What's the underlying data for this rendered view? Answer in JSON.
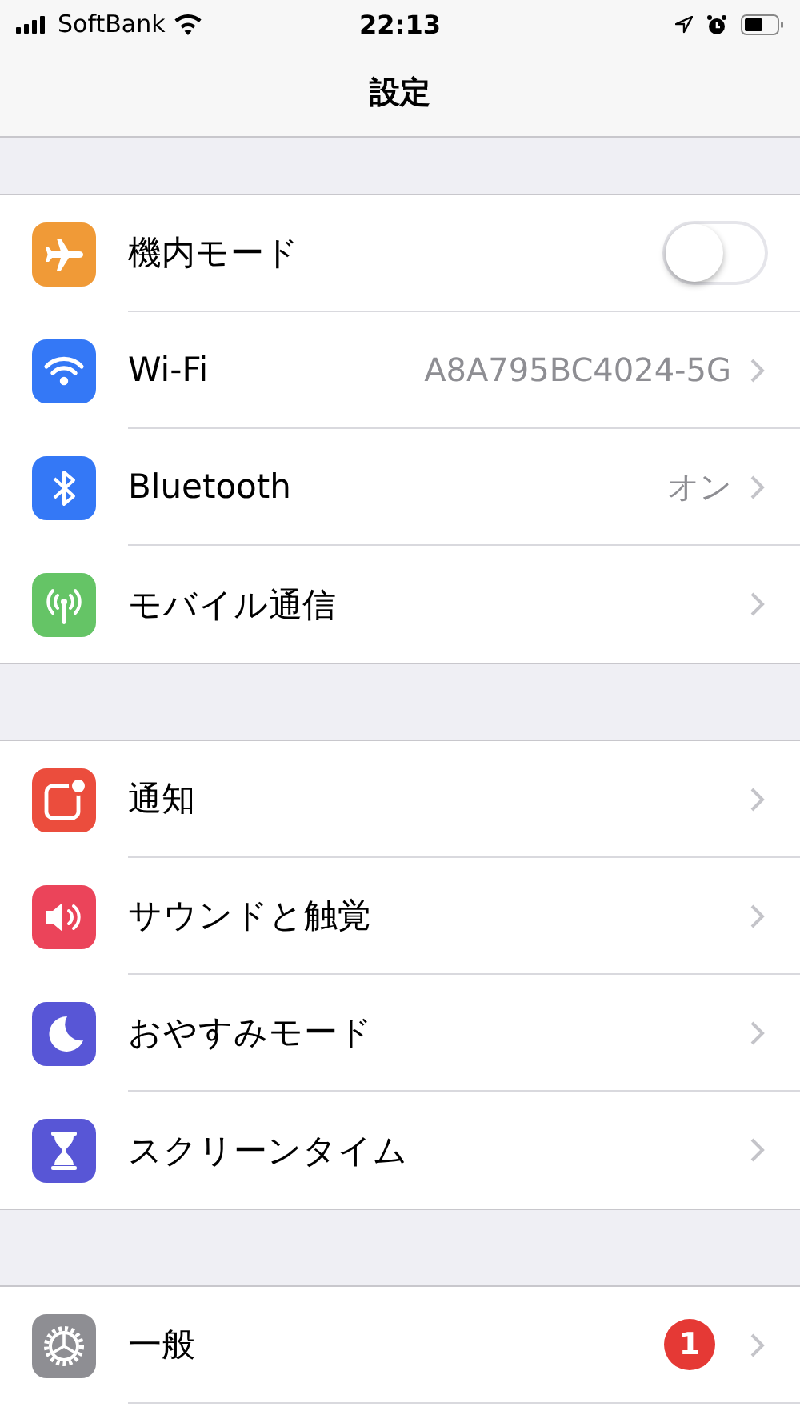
{
  "status_bar": {
    "carrier": "SoftBank",
    "time": "22:13"
  },
  "nav": {
    "title": "設定"
  },
  "groups": [
    {
      "rows": [
        {
          "kind": "toggle",
          "label": "機内モード",
          "color": "#f09a37",
          "on": false
        },
        {
          "kind": "link",
          "label": "Wi-Fi",
          "color": "#3478f6",
          "value": "A8A795BC4024-5G"
        },
        {
          "kind": "link",
          "label": "Bluetooth",
          "color": "#3478f6",
          "value": "オン"
        },
        {
          "kind": "link",
          "label": "モバイル通信",
          "color": "#65c466"
        }
      ]
    },
    {
      "rows": [
        {
          "kind": "link",
          "label": "通知",
          "color": "#eb4d3d"
        },
        {
          "kind": "link",
          "label": "サウンドと触覚",
          "color": "#eb445a"
        },
        {
          "kind": "link",
          "label": "おやすみモード",
          "color": "#5856d6"
        },
        {
          "kind": "link",
          "label": "スクリーンタイム",
          "color": "#5856d6"
        }
      ]
    },
    {
      "rows": [
        {
          "kind": "link",
          "label": "一般",
          "color": "#8e8e93",
          "badge": "1"
        }
      ]
    }
  ]
}
